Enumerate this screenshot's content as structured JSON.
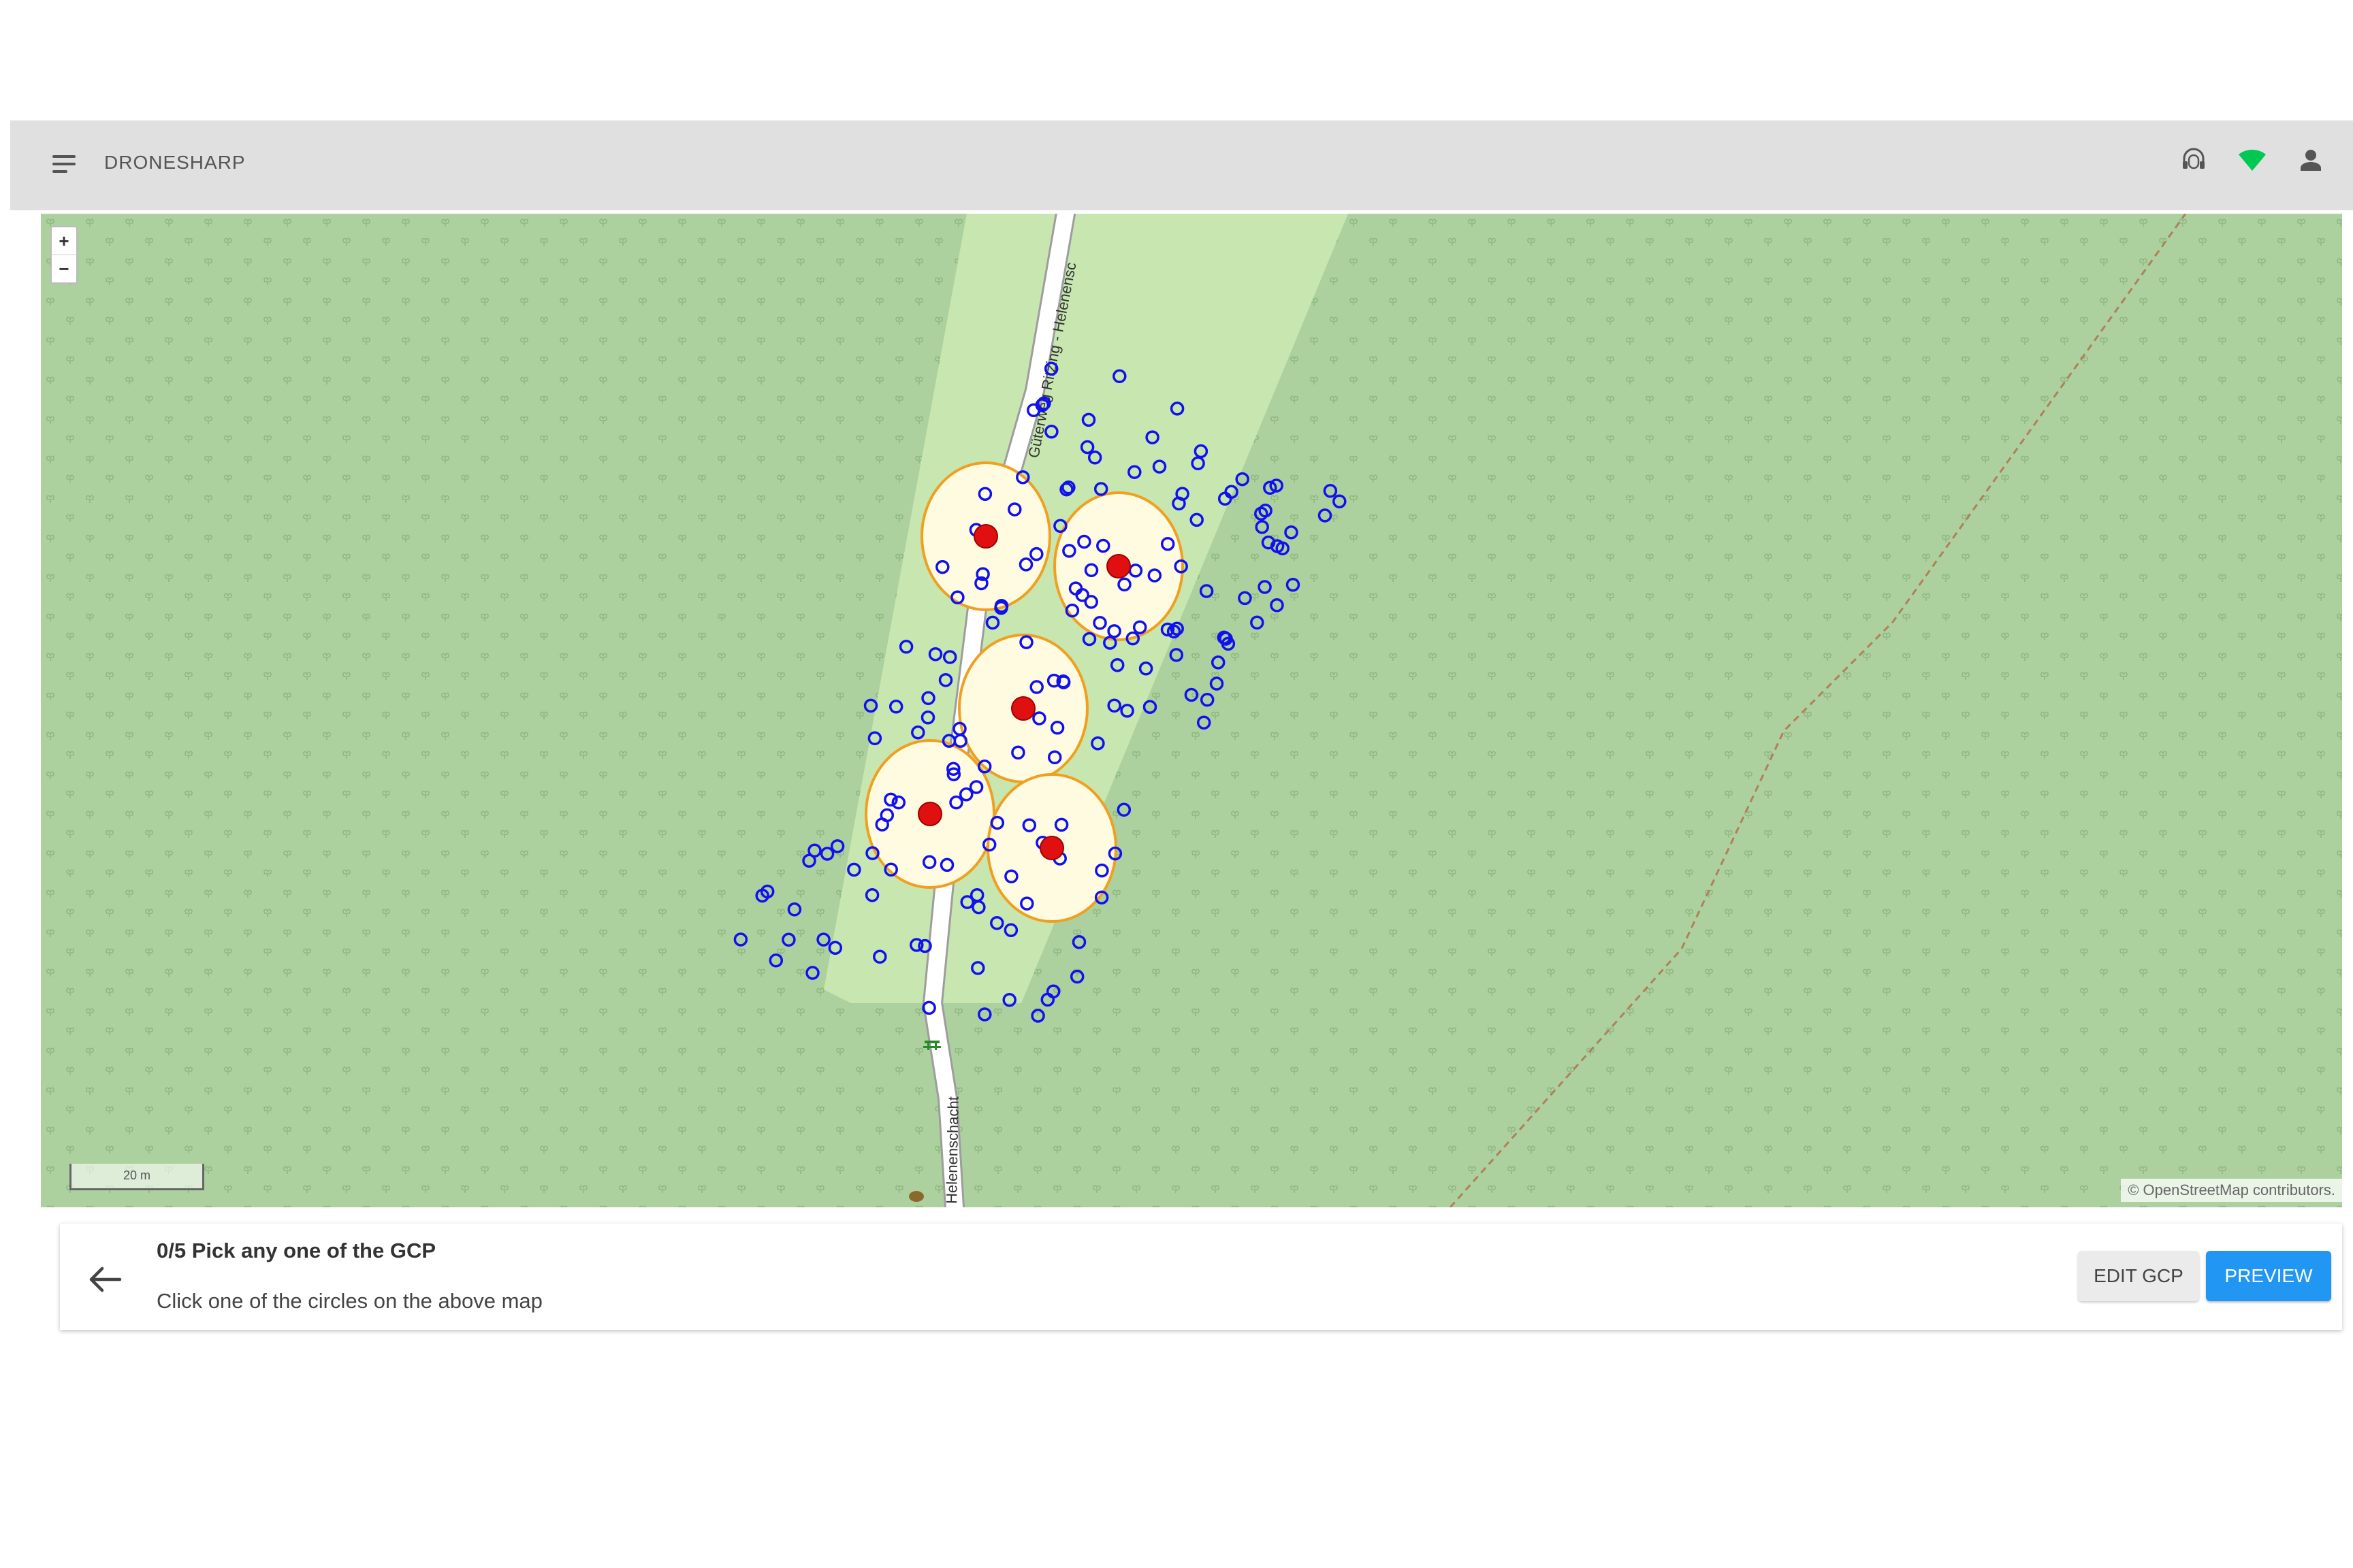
{
  "app": {
    "title": "DRONESHARP"
  },
  "header_icons": [
    "support-headset-icon",
    "wifi-signal-icon",
    "user-account-icon"
  ],
  "map": {
    "zoom_in_label": "+",
    "zoom_out_label": "−",
    "scale_label": "20 m",
    "attribution": "© OpenStreetMap contributors.",
    "road_labels": [
      "Güterweg Ritzing - Helenensc",
      "Helenenschacht"
    ],
    "colors": {
      "forest": "#add19e",
      "clearing": "#c8e7b0",
      "gcp_fill": "#fffbe0",
      "gcp_stroke": "#f0a020",
      "gcp_center": "#e01010",
      "image_marker": "#1010f0",
      "path": "#b0805a"
    },
    "gcp_count": 5,
    "image_marker_count": 180
  },
  "panel": {
    "title": "0/5 Pick any one of the GCP",
    "subtitle": "Click one of the circles on the above map",
    "edit_label": "EDIT GCP",
    "preview_label": "PREVIEW"
  },
  "colors": {
    "header_bg": "#e0e0e0",
    "primary": "#2196f3",
    "signal_green": "#00c853"
  }
}
